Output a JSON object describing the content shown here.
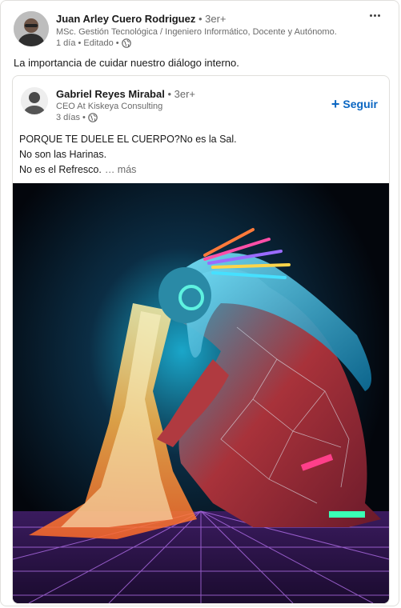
{
  "post": {
    "author": {
      "name": "Juan Arley Cuero Rodriguez",
      "degree": "• 3er+",
      "headline": "MSc. Gestión Tecnológica / Ingeniero Informático, Docente y Autónomo.",
      "time": "1 día • Editado •"
    },
    "commentary": "La importancia de cuidar nuestro diálogo interno.",
    "icons": {
      "menu": "ellipsis-icon",
      "visibility": "globe-icon"
    }
  },
  "reshare": {
    "author": {
      "name": "Gabriel Reyes Mirabal",
      "degree": "• 3er+",
      "headline": "CEO At Kiskeya Consulting",
      "time": "3 días •"
    },
    "follow_label": "Seguir",
    "text_lines": [
      "PORQUE TE DUELE EL CUERPO?No es la Sal.",
      "No son las Harinas.",
      "No es el Refresco."
    ],
    "see_more": "… más"
  },
  "colors": {
    "link_blue": "#0a66c2",
    "border": "#e0dfdc",
    "text_muted": "#666666"
  }
}
